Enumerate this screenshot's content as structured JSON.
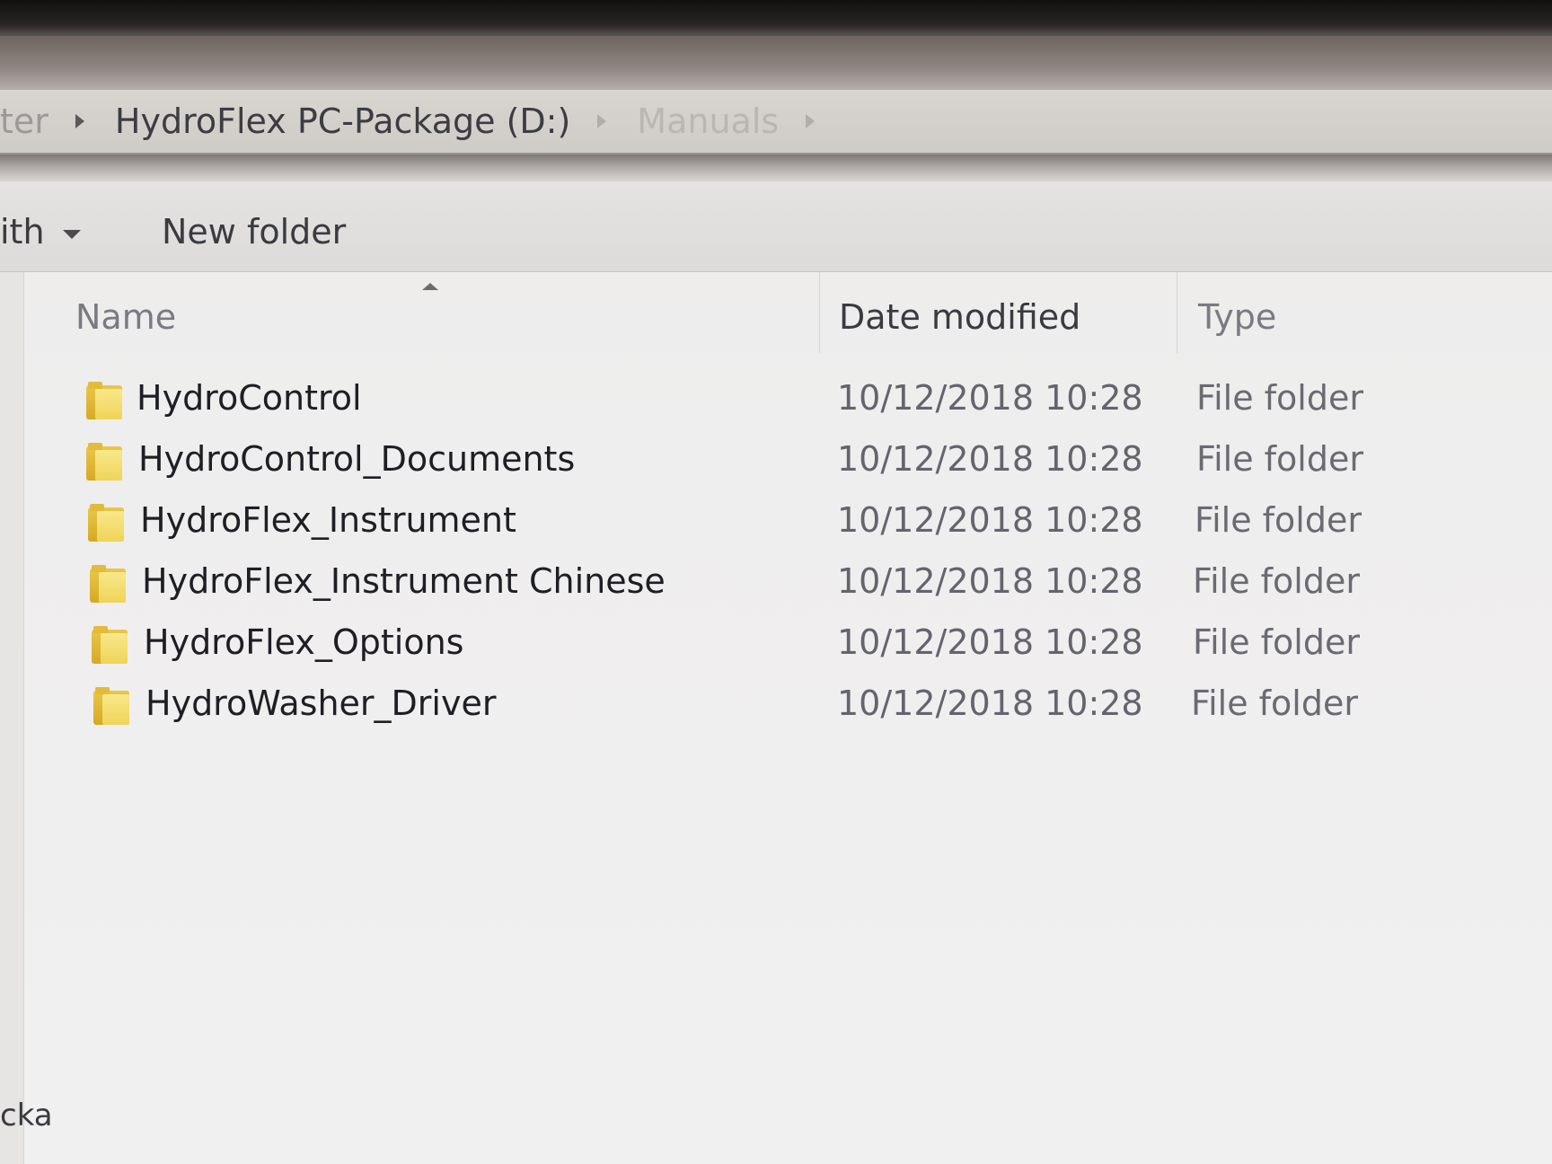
{
  "breadcrumb": {
    "items": [
      {
        "label": "ter",
        "style": "faded"
      },
      {
        "label": "HydroFlex PC-Package (D:)",
        "style": "normal"
      },
      {
        "label": "Manuals",
        "style": "current"
      }
    ]
  },
  "toolbar": {
    "share_with_label": "ith",
    "new_folder_label": "New folder"
  },
  "columns": {
    "name": "Name",
    "date_modified": "Date modified",
    "type": "Type"
  },
  "files": [
    {
      "name": "HydroControl",
      "date": "10/12/2018 10:28",
      "type": "File folder",
      "icon": "folder-icon"
    },
    {
      "name": "HydroControl_Documents",
      "date": "10/12/2018 10:28",
      "type": "File folder",
      "icon": "folder-icon"
    },
    {
      "name": "HydroFlex_Instrument",
      "date": "10/12/2018 10:28",
      "type": "File folder",
      "icon": "folder-icon"
    },
    {
      "name": "HydroFlex_Instrument Chinese",
      "date": "10/12/2018 10:28",
      "type": "File folder",
      "icon": "folder-icon"
    },
    {
      "name": "HydroFlex_Options",
      "date": "10/12/2018 10:28",
      "type": "File folder",
      "icon": "folder-icon"
    },
    {
      "name": "HydroWasher_Driver",
      "date": "10/12/2018 10:28",
      "type": "File folder",
      "icon": "folder-icon"
    }
  ],
  "status": {
    "text": "cka"
  },
  "colors": {
    "folder_yellow": "#efd458",
    "name_text": "#1e1e24",
    "meta_text": "#64646e"
  }
}
